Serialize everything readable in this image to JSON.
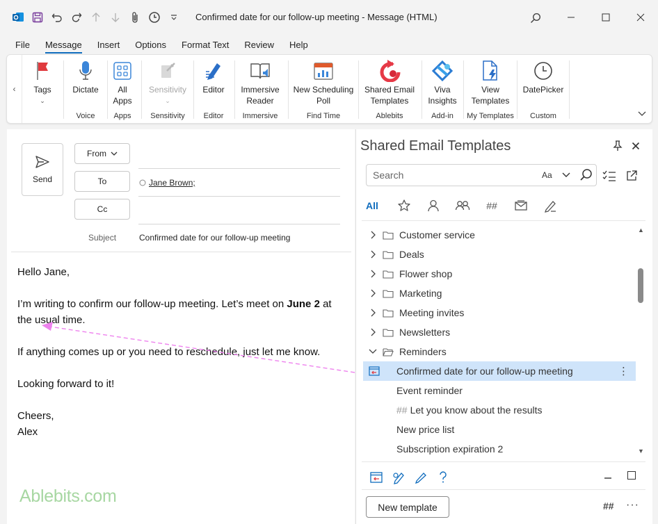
{
  "window": {
    "title": "Confirmed date for our follow-up meeting  -  Message (HTML)"
  },
  "menu_tabs": [
    "File",
    "Message",
    "Insert",
    "Options",
    "Format Text",
    "Review",
    "Help"
  ],
  "active_menu_tab": "Message",
  "ribbon": {
    "groups": [
      {
        "name": "",
        "buttons": [
          {
            "label": "Tags",
            "icon": "flag-icon"
          }
        ]
      },
      {
        "name": "Voice",
        "buttons": [
          {
            "label": "Dictate",
            "icon": "microphone-icon"
          }
        ]
      },
      {
        "name": "Apps",
        "buttons": [
          {
            "label": "All Apps",
            "icon": "apps-grid-icon"
          }
        ]
      },
      {
        "name": "Sensitivity",
        "buttons": [
          {
            "label": "Sensitivity",
            "icon": "sensitivity-icon",
            "disabled": true
          }
        ]
      },
      {
        "name": "Editor",
        "buttons": [
          {
            "label": "Editor",
            "icon": "editor-pen-icon"
          }
        ]
      },
      {
        "name": "Immersive",
        "buttons": [
          {
            "label": "Immersive Reader",
            "icon": "immersive-reader-icon"
          }
        ]
      },
      {
        "name": "Find Time",
        "buttons": [
          {
            "label": "New Scheduling Poll",
            "icon": "scheduling-poll-icon"
          }
        ]
      },
      {
        "name": "Ablebits",
        "buttons": [
          {
            "label": "Shared Email Templates",
            "icon": "shared-templates-icon"
          }
        ]
      },
      {
        "name": "Add-in",
        "buttons": [
          {
            "label": "Viva Insights",
            "icon": "viva-insights-icon"
          }
        ]
      },
      {
        "name": "My Templates",
        "buttons": [
          {
            "label": "View Templates",
            "icon": "view-templates-icon"
          }
        ]
      },
      {
        "name": "Custom",
        "buttons": [
          {
            "label": "DatePicker",
            "icon": "clock-icon"
          }
        ]
      }
    ]
  },
  "compose": {
    "send_label": "Send",
    "from_label": "From",
    "to_label": "To",
    "cc_label": "Cc",
    "recipient": "Jane Brown;",
    "subject_label": "Subject",
    "subject_value": "Confirmed date for our follow-up meeting",
    "body": {
      "greeting": "Hello Jane,",
      "line1a": "I’m writing to confirm our follow-up meeting. Let’s meet on",
      "line1_bold": "June 2",
      "line1b": " at the usual time.",
      "line2": "If anything comes up or you need to reschedule, just let me know.",
      "line3": "Looking forward to it!",
      "closing": "Cheers,",
      "signature": "Alex"
    },
    "watermark": "Ablebits.com"
  },
  "pane": {
    "title": "Shared Email Templates",
    "search_placeholder": "Search",
    "match_case": "Aa",
    "tab_all": "All",
    "tab_hash": "##",
    "folders": [
      {
        "name": "Customer service",
        "expanded": false
      },
      {
        "name": "Deals",
        "expanded": false
      },
      {
        "name": "Flower shop",
        "expanded": false
      },
      {
        "name": "Marketing",
        "expanded": false
      },
      {
        "name": "Meeting invites",
        "expanded": false
      },
      {
        "name": "Newsletters",
        "expanded": false
      },
      {
        "name": "Reminders",
        "expanded": true
      }
    ],
    "templates": [
      {
        "name": "Confirmed date for our follow-up meeting",
        "selected": true,
        "hash": false
      },
      {
        "name": "Event reminder",
        "selected": false,
        "hash": false
      },
      {
        "name": "Let you know about the results",
        "selected": false,
        "hash": true
      },
      {
        "name": "New price list",
        "selected": false,
        "hash": false
      },
      {
        "name": "Subscription expiration 2",
        "selected": false,
        "hash": false
      }
    ],
    "hash_prefix": "##",
    "new_template_label": "New template",
    "footer_hash": "##",
    "more_label": "···"
  },
  "colors": {
    "accent": "#0f6cbd",
    "selection": "#cfe4fa",
    "arrow": "#ee82ee",
    "watermark": "#a7d7a2"
  }
}
